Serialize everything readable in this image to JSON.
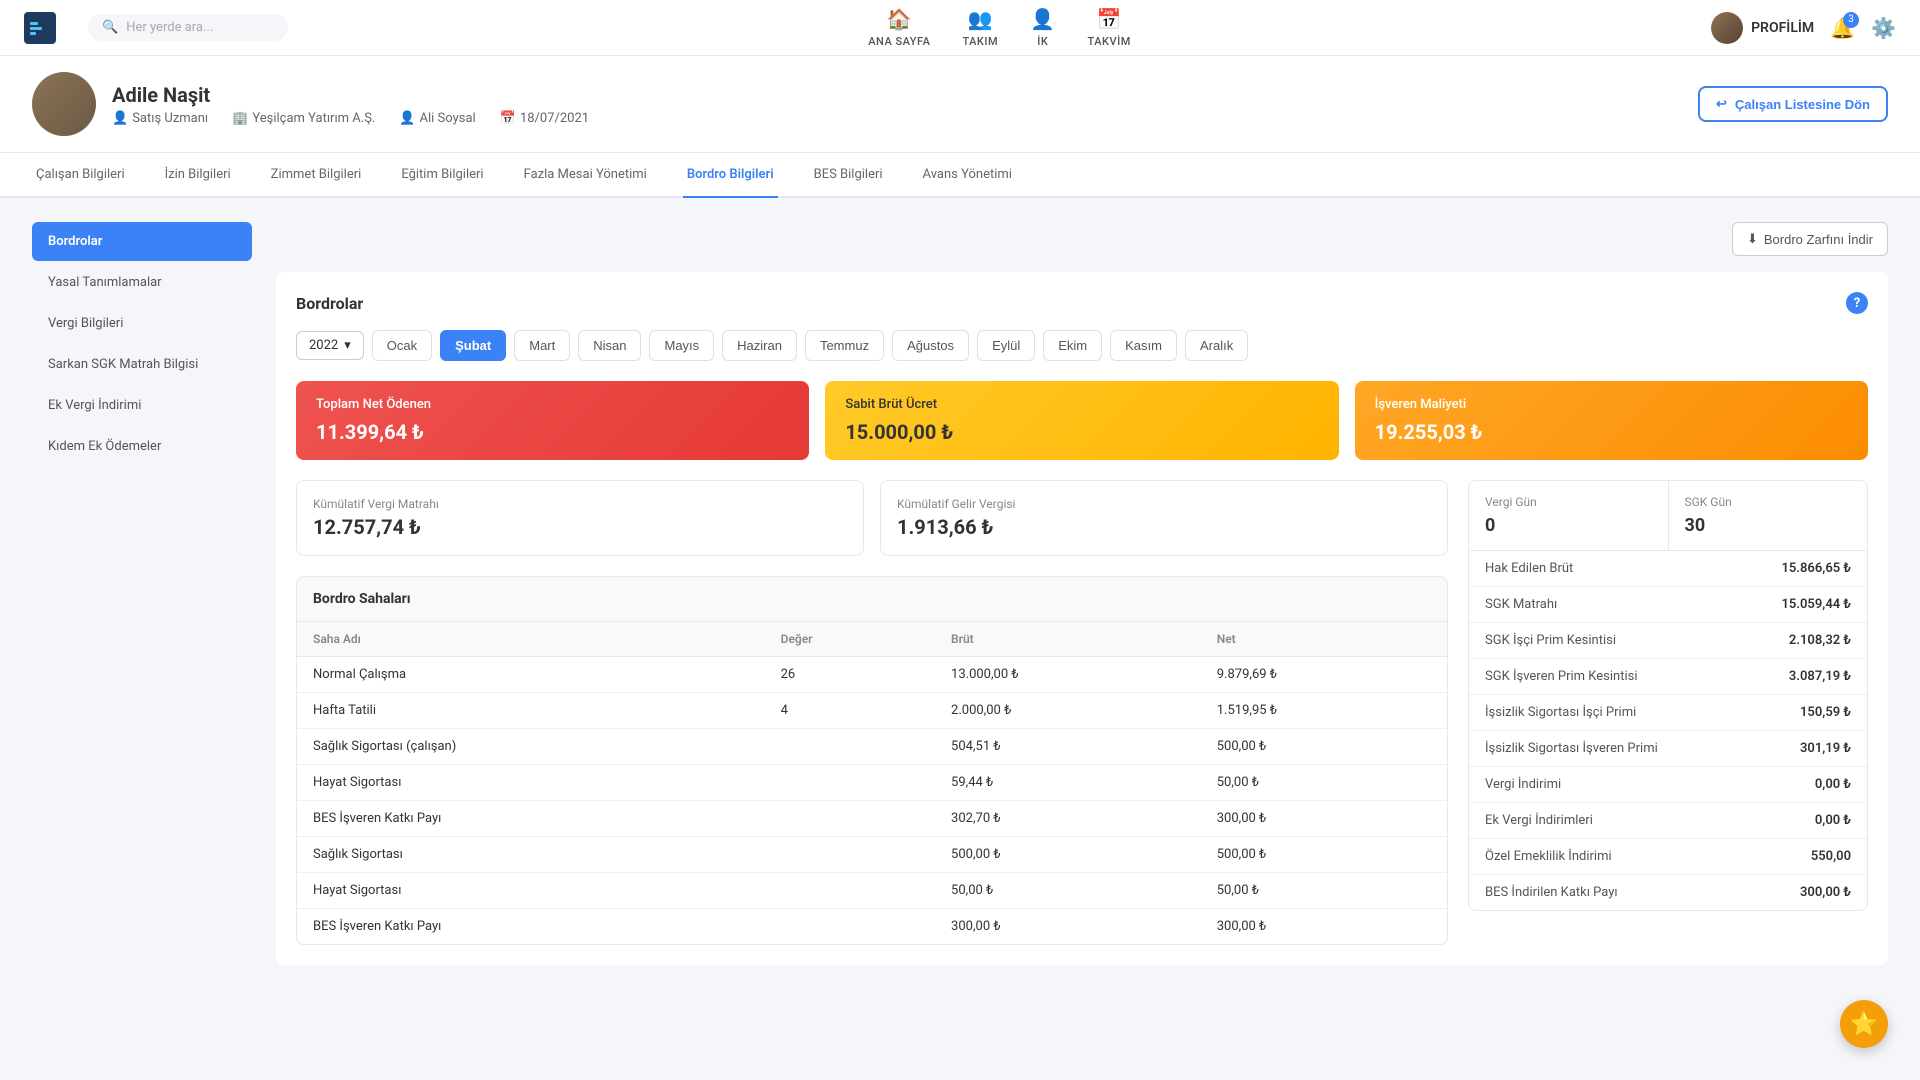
{
  "nav": {
    "search_placeholder": "Her yerde ara...",
    "items": [
      {
        "id": "ana-sayfa",
        "label": "ANA SAYFA",
        "icon": "🏠"
      },
      {
        "id": "takim",
        "label": "TAKIM",
        "icon": "👥"
      },
      {
        "id": "ik",
        "label": "İK",
        "icon": "👤"
      },
      {
        "id": "takvim",
        "label": "TAKVİM",
        "icon": "📅"
      }
    ],
    "profile_label": "PROFİLİM",
    "notif_count": "3"
  },
  "employee": {
    "name": "Adile Naşit",
    "role": "Satış Uzmanı",
    "company": "Yeşilçam Yatırım A.Ş.",
    "manager": "Ali Soysal",
    "date": "18/07/2021",
    "back_btn": "Çalışan Listesine Dön"
  },
  "tabs": [
    {
      "id": "calisan",
      "label": "Çalışan Bilgileri"
    },
    {
      "id": "izin",
      "label": "İzin Bilgileri"
    },
    {
      "id": "zimmet",
      "label": "Zimmet Bilgileri"
    },
    {
      "id": "egitim",
      "label": "Eğitim Bilgileri"
    },
    {
      "id": "fazlamesi",
      "label": "Fazla Mesai Yönetimi"
    },
    {
      "id": "bordro",
      "label": "Bordro Bilgileri",
      "active": true
    },
    {
      "id": "bes",
      "label": "BES Bilgileri"
    },
    {
      "id": "avans",
      "label": "Avans Yönetimi"
    }
  ],
  "sidebar": {
    "items": [
      {
        "id": "bordrolar",
        "label": "Bordrolar",
        "active": true
      },
      {
        "id": "yasal",
        "label": "Yasal Tanımlamalar"
      },
      {
        "id": "vergi",
        "label": "Vergi Bilgileri"
      },
      {
        "id": "sarkan",
        "label": "Sarkan SGK Matrah Bilgisi"
      },
      {
        "id": "ek-vergi",
        "label": "Ek Vergi İndirimi"
      },
      {
        "id": "kidem",
        "label": "Kıdem Ek Ödemeler"
      }
    ]
  },
  "bordro": {
    "title": "Bordrolar",
    "download_btn": "Bordro Zarfını İndir",
    "year": "2022",
    "months": [
      {
        "id": "ocak",
        "label": "Ocak"
      },
      {
        "id": "subat",
        "label": "Şubat",
        "active": true
      },
      {
        "id": "mart",
        "label": "Mart"
      },
      {
        "id": "nisan",
        "label": "Nisan"
      },
      {
        "id": "mayis",
        "label": "Mayıs"
      },
      {
        "id": "haziran",
        "label": "Haziran"
      },
      {
        "id": "temmuz",
        "label": "Temmuz"
      },
      {
        "id": "agustos",
        "label": "Ağustos"
      },
      {
        "id": "eylul",
        "label": "Eylül"
      },
      {
        "id": "ekim",
        "label": "Ekim"
      },
      {
        "id": "kasim",
        "label": "Kasım"
      },
      {
        "id": "aralik",
        "label": "Aralık"
      }
    ],
    "cards": {
      "toplam_label": "Toplam Net Ödenen",
      "toplam_value": "11.399,64 ₺",
      "sabit_label": "Sabit Brüt Ücret",
      "sabit_value": "15.000,00 ₺",
      "isveren_label": "İşveren Maliyeti",
      "isveren_value": "19.255,03 ₺"
    },
    "kumülatif": {
      "matrah_label": "Kümülatif Vergi Matrahı",
      "matrah_value": "12.757,74 ₺",
      "gelir_label": "Kümülatif Gelir Vergisi",
      "gelir_value": "1.913,66 ₺"
    },
    "vg": {
      "vergi_gun_label": "Vergi Gün",
      "vergi_gun_value": "0",
      "sgk_gun_label": "SGK Gün",
      "sgk_gun_value": "30"
    },
    "right_stats": [
      {
        "label": "Hak Edilen Brüt",
        "value": "15.866,65 ₺"
      },
      {
        "label": "SGK Matrahı",
        "value": "15.059,44 ₺"
      },
      {
        "label": "SGK İşçi Prim Kesintisi",
        "value": "2.108,32 ₺"
      },
      {
        "label": "SGK İşveren Prim Kesintisi",
        "value": "3.087,19 ₺"
      },
      {
        "label": "İşsizlik Sigortası İşçi Primi",
        "value": "150,59 ₺"
      },
      {
        "label": "İşsizlik Sigortası İşveren Primi",
        "value": "301,19 ₺"
      },
      {
        "label": "Vergi İndirimi",
        "value": "0,00 ₺"
      },
      {
        "label": "Ek Vergi İndirimleri",
        "value": "0,00 ₺"
      },
      {
        "label": "Özel Emeklilik İndirimi",
        "value": "550,00"
      },
      {
        "label": "BES İndirilen Katkı Payı",
        "value": "300,00 ₺"
      }
    ],
    "table": {
      "title": "Bordro Sahaları",
      "columns": [
        "Saha Adı",
        "Değer",
        "Brüt",
        "Net"
      ],
      "rows": [
        {
          "saha": "Normal Çalışma",
          "deger": "26",
          "brut": "13.000,00 ₺",
          "net": "9.879,69 ₺"
        },
        {
          "saha": "Hafta Tatili",
          "deger": "4",
          "brut": "2.000,00 ₺",
          "net": "1.519,95 ₺"
        },
        {
          "saha": "Sağlık Sigortası (çalışan)",
          "deger": "",
          "brut": "504,51 ₺",
          "net": "500,00 ₺"
        },
        {
          "saha": "Hayat Sigortası",
          "deger": "",
          "brut": "59,44 ₺",
          "net": "50,00 ₺"
        },
        {
          "saha": "BES İşveren Katkı Payı",
          "deger": "",
          "brut": "302,70 ₺",
          "net": "300,00 ₺"
        },
        {
          "saha": "Sağlık Sigortası",
          "deger": "",
          "brut": "500,00 ₺",
          "net": "500,00 ₺"
        },
        {
          "saha": "Hayat Sigortası",
          "deger": "",
          "brut": "50,00 ₺",
          "net": "50,00 ₺"
        },
        {
          "saha": "BES İşveren Katkı Payı",
          "deger": "",
          "brut": "300,00 ₺",
          "net": "300,00 ₺"
        }
      ]
    }
  }
}
